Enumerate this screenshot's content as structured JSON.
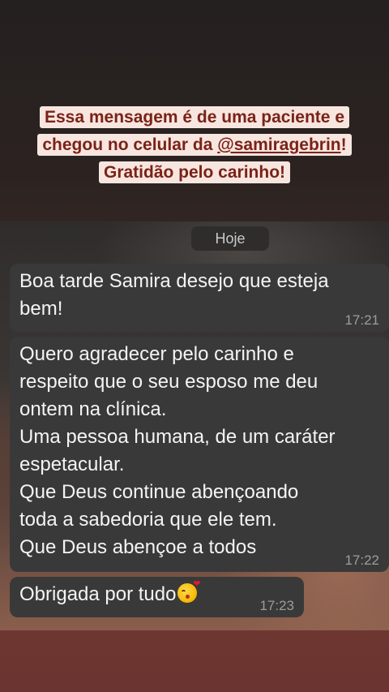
{
  "caption": {
    "line1": "Essa mensagem é de uma paciente e",
    "line2_prefix": "chegou no celular da ",
    "line2_handle": "@samiragebrin",
    "line2_suffix": "!",
    "line3": "Gratidão pelo carinho!"
  },
  "chat": {
    "date_chip": "Hoje",
    "messages": [
      {
        "text": "Boa tarde Samira desejo que esteja\nbem!",
        "time": "17:21"
      },
      {
        "text": "Quero agradecer pelo carinho e\nrespeito que o seu esposo me deu\nontem na clínica.\nUma pessoa humana, de um caráter\nespetacular.\nQue Deus continue abençoando\ntoda a sabedoria que ele tem.\nQue Deus abençoe a todos",
        "time": "17:22"
      },
      {
        "text": "Obrigada por tudo",
        "emoji": "face-blowing-a-kiss",
        "time": "17:23"
      }
    ]
  },
  "colors": {
    "caption_text": "#7a2218",
    "caption_bg": "#f7e6df",
    "bubble_bg": "#3a3939",
    "bubble_text": "#f4f4f4",
    "time_text": "#9c9c9c"
  }
}
